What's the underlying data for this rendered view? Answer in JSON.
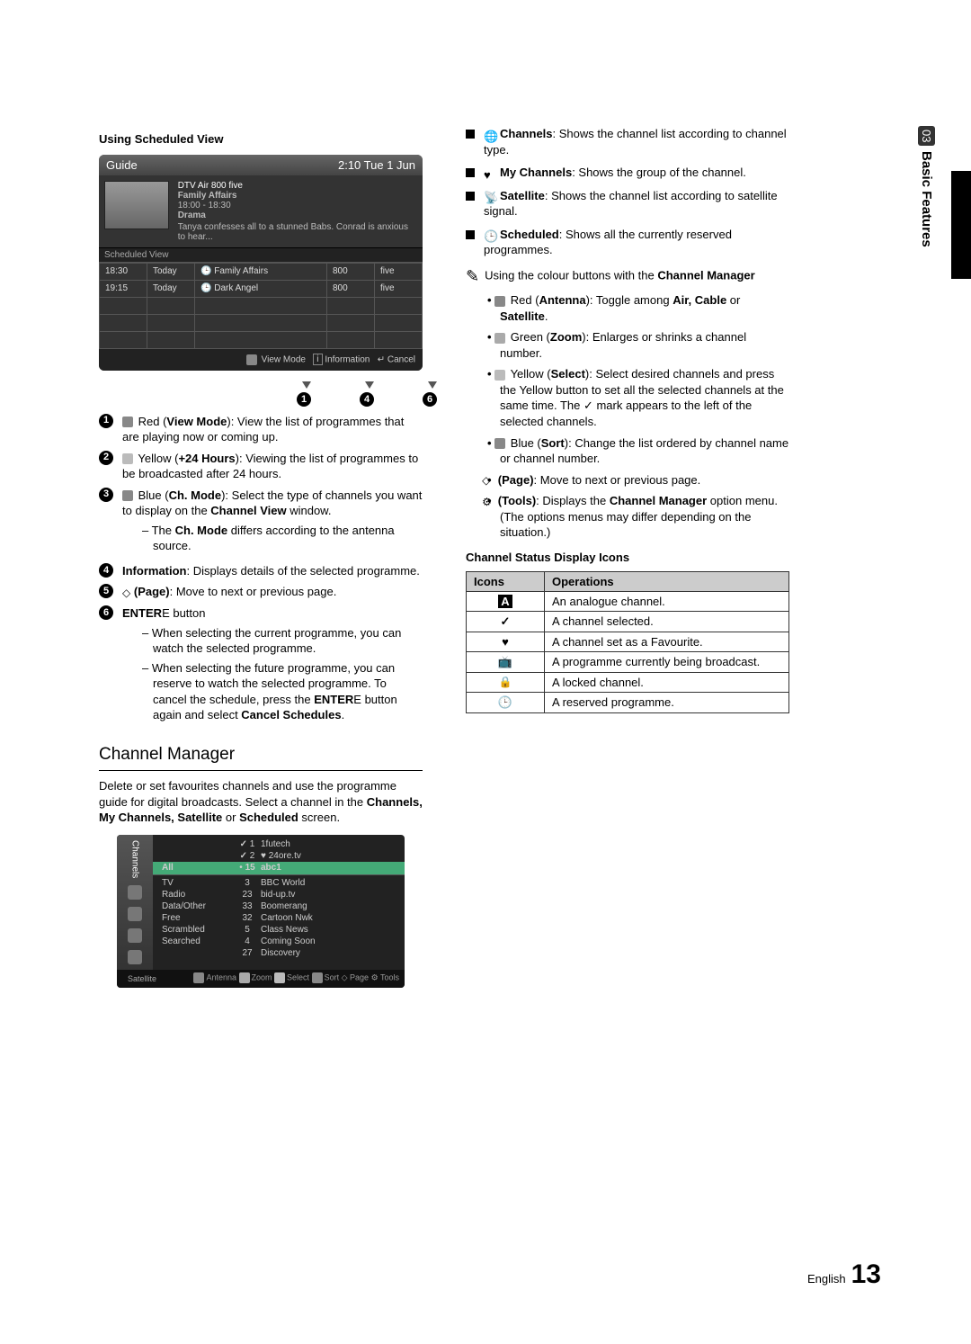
{
  "sideTab": {
    "num": "03",
    "label": "Basic Features"
  },
  "left": {
    "heading": "Using Scheduled View",
    "guide": {
      "title": "Guide",
      "time": "2:10 Tue 1 Jun",
      "channel": "DTV Air 800 five",
      "programme": "Family Affairs",
      "slot": "18:00 - 18:30",
      "genre": "Drama",
      "desc": "Tanya confesses all to a stunned Babs. Conrad is anxious to hear...",
      "section": "Scheduled View",
      "rows": [
        {
          "t": "18:30",
          "d": "Today",
          "p": "Family Affairs",
          "n": "800",
          "c": "five"
        },
        {
          "t": "19:15",
          "d": "Today",
          "p": "Dark Angel",
          "n": "800",
          "c": "five"
        }
      ],
      "foot": {
        "a": "View Mode",
        "b": "Information",
        "c": "Cancel"
      }
    },
    "markers": {
      "m1": "1",
      "m4": "4",
      "m6": "6"
    },
    "items": [
      {
        "n": "1",
        "pre": "Red (",
        "lab": "View Mode",
        "post": "): View the list of programmes that are playing now or coming up.",
        "btn": "r"
      },
      {
        "n": "2",
        "pre": "Yellow (",
        "lab": "+24 Hours",
        "post": "): Viewing the list of programmes to be broadcasted after 24 hours.",
        "btn": "y"
      },
      {
        "n": "3",
        "pre": "Blue (",
        "lab": "Ch. Mode",
        "post": "): Select the type of channels you want to display on the ",
        "post2": "Channel View",
        "post3": " window.",
        "btn": "b"
      },
      {
        "n": "4",
        "lab": "Information",
        "post": ": Displays details of the selected programme."
      },
      {
        "n": "5",
        "lab": "(Page)",
        "post": ": Move to next or previous page.",
        "pg": true
      },
      {
        "n": "6",
        "lab": "ENTER",
        "enterIcon": "E",
        "post": " button"
      }
    ],
    "sub3": "The Ch. Mode differs according to the antenna source.",
    "sub6a": "When selecting the current programme, you can watch the selected programme.",
    "sub6b_1": "When selecting the future programme, you can reserve to watch the selected programme. To cancel the schedule, press the ",
    "sub6b_2": "ENTER",
    "sub6b_3": " button again and select ",
    "sub6b_4": "Cancel Schedules",
    "sub6b_5": ".",
    "cmTitle": "Channel Manager",
    "cmDesc1": "Delete or set favourites channels and use the programme guide for digital broadcasts. Select a channel in the ",
    "cmDesc2": "Channels, My Channels, Satellite",
    "cmDesc3": " or ",
    "cmDesc4": "Scheduled",
    "cmDesc5": " screen.",
    "cmBox": {
      "sideLabel": "Channels",
      "satLabel": "Satellite",
      "topRows": [
        {
          "ck": "✓",
          "n": "1",
          "c": "1futech"
        },
        {
          "ck": "✓",
          "n": "2",
          "c": "24ore.tv",
          "fav": true
        }
      ],
      "selRow": {
        "cat": "All",
        "n": "15",
        "c": "abc1",
        "dot": "•"
      },
      "cats": [
        "TV",
        "Radio",
        "Data/Other",
        "Free",
        "Scrambled",
        "Searched"
      ],
      "nums": [
        "3",
        "23",
        "33",
        "32",
        "5",
        "4",
        "27"
      ],
      "names": [
        "BBC World",
        "bid-up.tv",
        "Boomerang",
        "Cartoon Nwk",
        "Class News",
        "Coming Soon",
        "Discovery"
      ],
      "foot": [
        "Antenna",
        "Zoom",
        "Select",
        "Sort",
        "Page",
        "Tools"
      ]
    }
  },
  "right": {
    "blist": [
      {
        "icon": "🌐",
        "lab": "Channels",
        "txt": ": Shows the channel list according to channel type."
      },
      {
        "icon": "♥",
        "lab": "My Channels",
        "txt": ": Shows the group of the channel."
      },
      {
        "icon": "📡",
        "lab": "Satellite",
        "txt": ": Shows the channel list according to satellite signal."
      },
      {
        "icon": "🕒",
        "lab": "Scheduled",
        "txt": ": Shows all the currently reserved programmes."
      }
    ],
    "noteHead": "Using the colour buttons with the ",
    "noteHead2": "Channel Manager",
    "dots": [
      {
        "btn": "r",
        "pre": "Red (",
        "lab": "Antenna",
        "mid": "): Toggle among ",
        "b2": "Air, Cable",
        "mid2": " or ",
        "b3": "Satellite",
        "end": "."
      },
      {
        "btn": "g",
        "pre": "Green (",
        "lab": "Zoom",
        "end": "): Enlarges or shrinks a channel number."
      },
      {
        "btn": "y",
        "pre": "Yellow (",
        "lab": "Select",
        "end": "): Select desired channels and press the Yellow button to set all the selected channels at the same time. The ✓ mark appears to the left of the selected channels."
      },
      {
        "btn": "b",
        "pre": "Blue (",
        "lab": "Sort",
        "end": "): Change the list ordered by channel name or channel number."
      },
      {
        "pg": true,
        "lab": "(Page)",
        "end": ": Move to next or previous page."
      },
      {
        "tools": true,
        "lab": "(Tools)",
        "end": ": Displays the ",
        "b2": "Channel Manager",
        "end2": " option menu. (The options menus may differ depending on the situation.)"
      }
    ],
    "statusHead": "Channel Status Display Icons",
    "th1": "Icons",
    "th2": "Operations",
    "statusRows": [
      {
        "i": "A",
        "t": "An analogue channel.",
        "boxed": true
      },
      {
        "i": "✓",
        "t": "A channel selected."
      },
      {
        "i": "♥",
        "t": "A channel set as a Favourite."
      },
      {
        "i": "📺",
        "t": "A programme currently being broadcast."
      },
      {
        "i": "🔒",
        "t": "A locked channel."
      },
      {
        "i": "🕒",
        "t": "A reserved programme."
      }
    ]
  },
  "footer": {
    "lang": "English",
    "page": "13"
  }
}
